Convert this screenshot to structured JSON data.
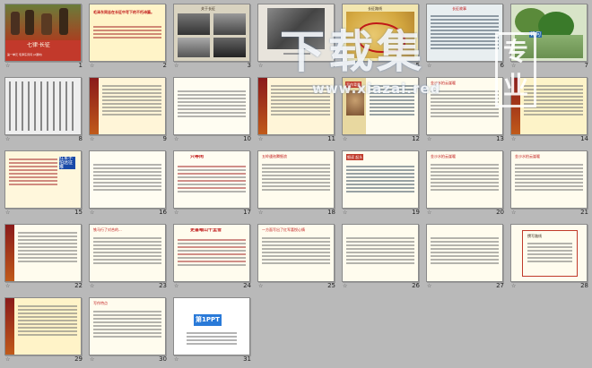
{
  "slides": [
    {
      "num": "1",
      "title": "七律·长征",
      "subtitle": "第一单元 毛泽东诗词 (2课时)"
    },
    {
      "num": "2",
      "title": "长征",
      "text": "毛泽东同志在长征中写下的不朽诗篇。"
    },
    {
      "num": "3",
      "title": "关于长征"
    },
    {
      "num": "4"
    },
    {
      "num": "5",
      "title": "长征路线"
    },
    {
      "num": "6",
      "title": "长征故事"
    },
    {
      "num": "7",
      "title": "七律",
      "text": "七言律诗的简称。"
    },
    {
      "num": "8"
    },
    {
      "num": "9",
      "text": "逶迤(wēi yí) 磅礴(páng bó)"
    },
    {
      "num": "10"
    },
    {
      "num": "11"
    },
    {
      "num": "12",
      "title": "写作背景"
    },
    {
      "num": "13",
      "title": "金沙水拍云崖暖"
    },
    {
      "num": "14"
    },
    {
      "num": "15",
      "text": "红军不怕远征难"
    },
    {
      "num": "16"
    },
    {
      "num": "17",
      "title": "只等闲"
    },
    {
      "num": "18",
      "text": "五岭逶迤腾细浪"
    },
    {
      "num": "19",
      "title": "细读 起头"
    },
    {
      "num": "20",
      "text": "金沙水拍云崖暖"
    },
    {
      "num": "21",
      "text": "金沙水拍云崖暖"
    },
    {
      "num": "22",
      "text": "大渡桥横铁索寒"
    },
    {
      "num": "23",
      "text": "铁马行了对合的..."
    },
    {
      "num": "24",
      "text": "更喜岷山千里雪"
    },
    {
      "num": "25",
      "text": "一方面写出了红军喜悦心情"
    },
    {
      "num": "26"
    },
    {
      "num": "27"
    },
    {
      "num": "28",
      "text": "撰写路线"
    },
    {
      "num": "29",
      "title": "中心思想"
    },
    {
      "num": "30",
      "title": "写作特点"
    },
    {
      "num": "31",
      "title": "第1PPT"
    }
  ],
  "watermark": {
    "main": "下载集",
    "url": "www.xiazai.red",
    "box": "专业"
  }
}
